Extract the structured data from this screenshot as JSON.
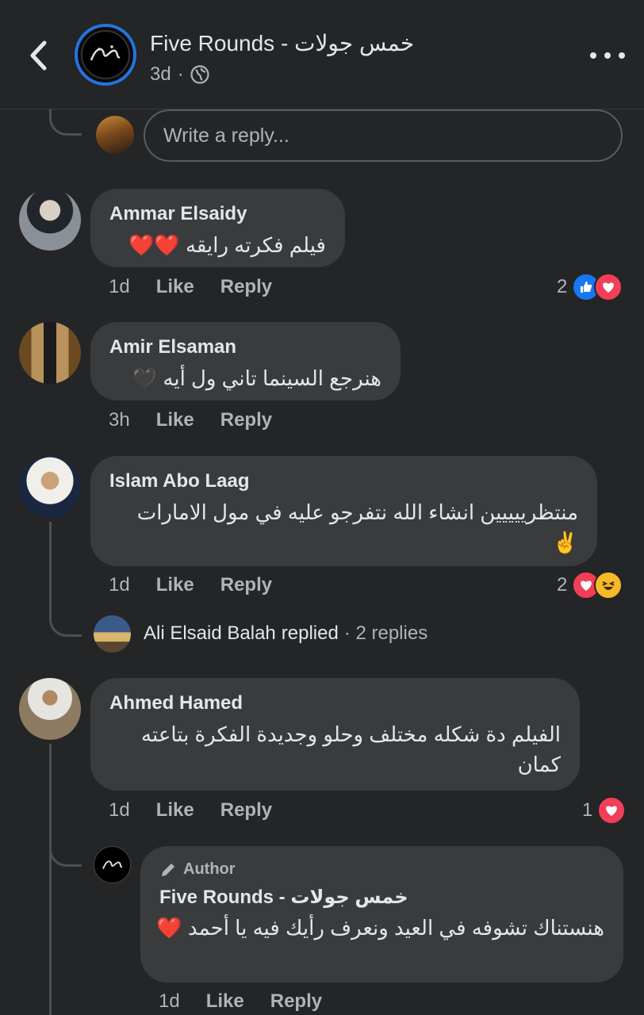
{
  "header": {
    "page_name": "Five Rounds - خمس جولات",
    "time": "3d",
    "separator": "·",
    "icons": {
      "back": "chevron-left-icon",
      "privacy": "globe-icon",
      "more": "more-dots-icon"
    }
  },
  "reply_box": {
    "placeholder": "Write a reply..."
  },
  "comments": [
    {
      "author": "Ammar Elsaidy",
      "text": "فيلم فكرته رايقه ❤️❤️",
      "time": "1d",
      "like": "Like",
      "reply": "Reply",
      "reaction_count": "2",
      "reactions": [
        "like",
        "love"
      ]
    },
    {
      "author": "Amir Elsaman",
      "text": "هنرجع السينما تاني ول أيه 🖤",
      "time": "3h",
      "like": "Like",
      "reply": "Reply"
    },
    {
      "author": "Islam Abo Laag",
      "text": "منتظرييييين انشاء الله نتفرجو عليه في مول الامارات ✌️",
      "time": "1d",
      "like": "Like",
      "reply": "Reply",
      "reaction_count": "2",
      "reactions": [
        "love",
        "haha"
      ],
      "replies_summary": {
        "name": "Ali Elsaid Balah",
        "replied": "replied",
        "count": "· 2 replies"
      }
    },
    {
      "author": "Ahmed Hamed",
      "text": "الفيلم دة شكله مختلف وحلو وجديدة الفكرة بتاعته كمان",
      "time": "1d",
      "like": "Like",
      "reply": "Reply",
      "reaction_count": "1",
      "reactions": [
        "love"
      ]
    }
  ],
  "author_reply": {
    "badge": "Author",
    "author": "Five Rounds - خمس جولات",
    "text": "هنستناك تشوفه في العيد ونعرف رأيك فيه يا أحمد ❤️",
    "time": "1d",
    "like": "Like",
    "reply": "Reply"
  },
  "colors": {
    "background": "#242526",
    "bubble": "#3a3b3c",
    "accent": "#2374e1",
    "love": "#f33e58",
    "like": "#1877f2"
  }
}
